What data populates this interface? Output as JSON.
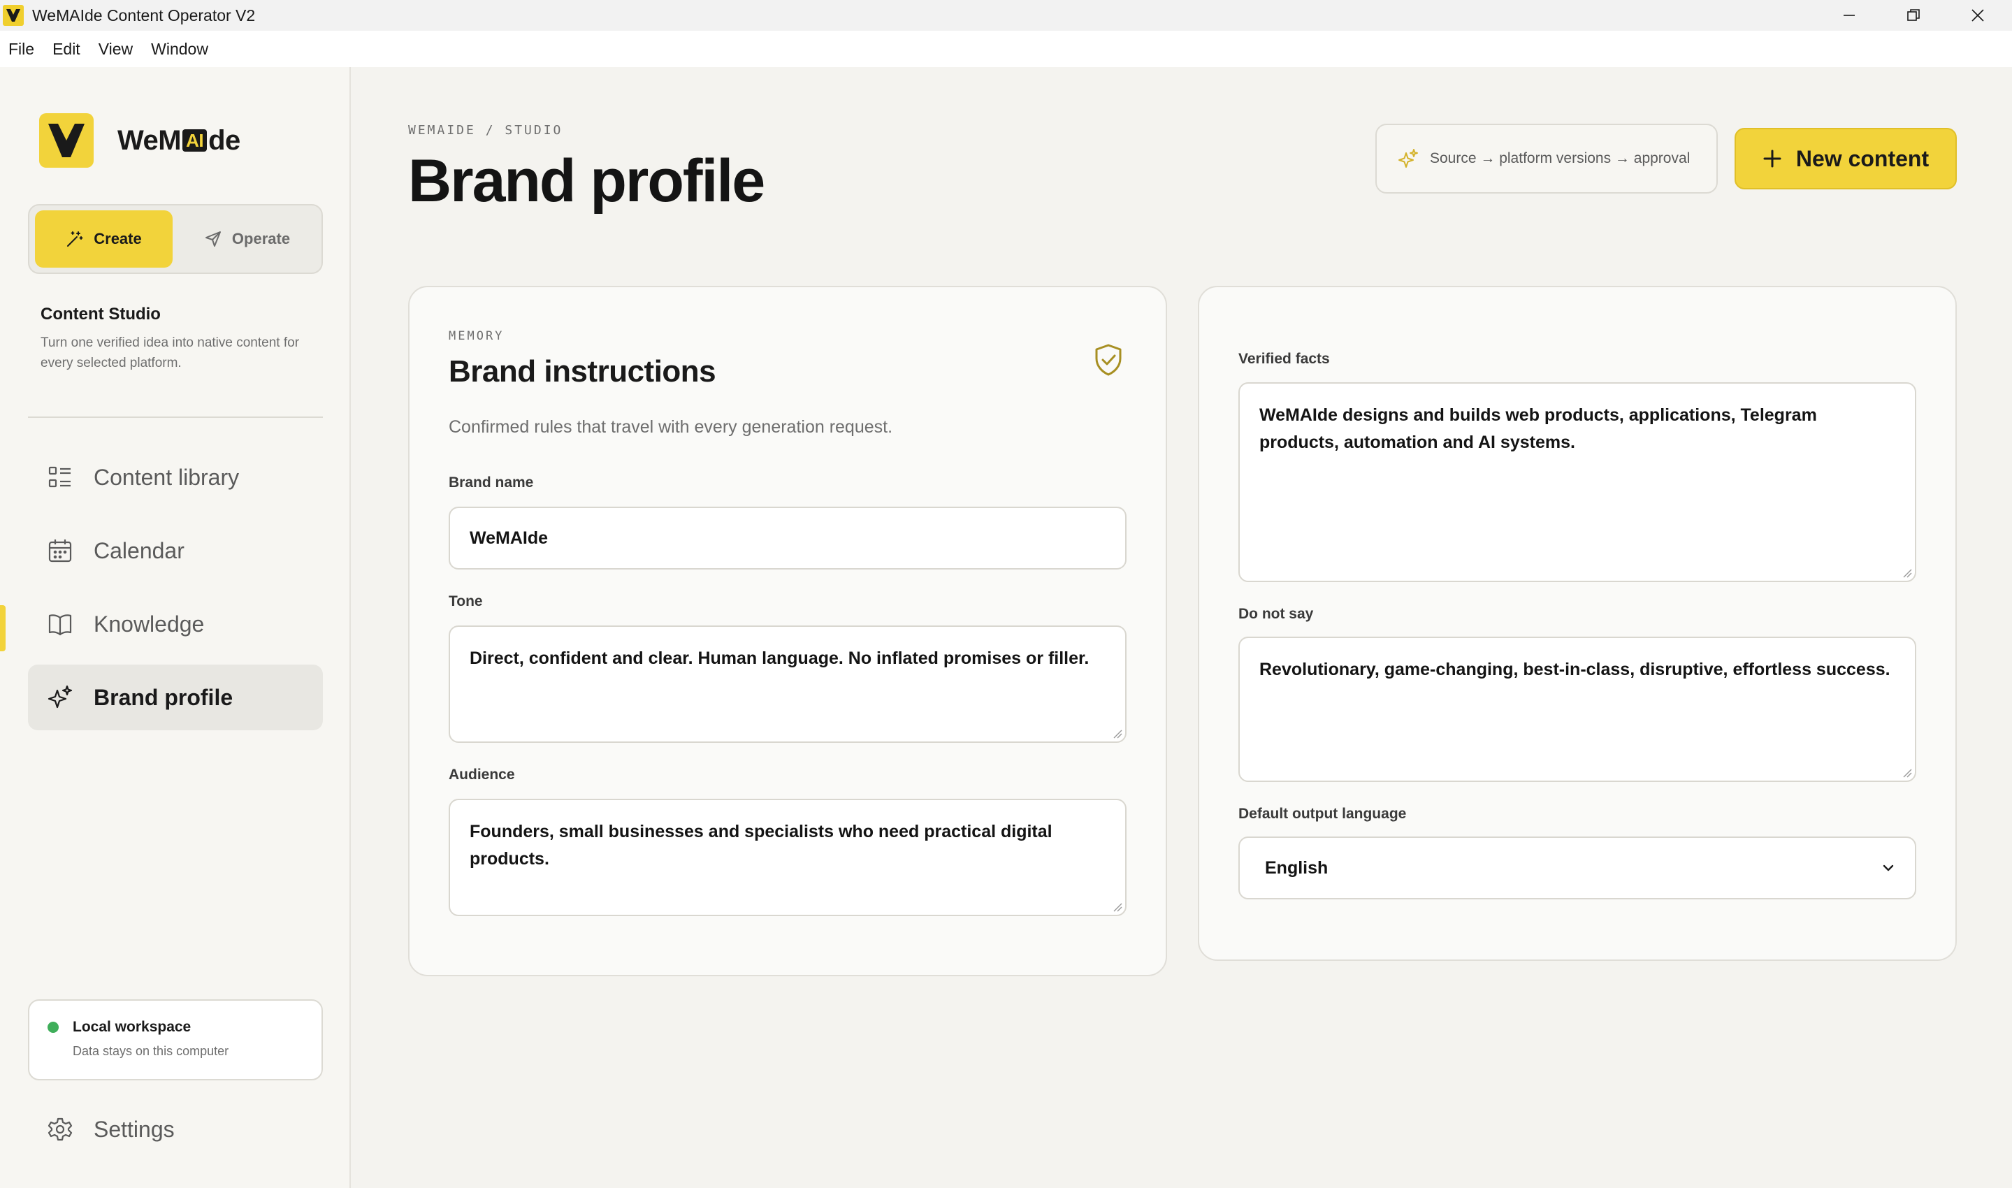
{
  "window": {
    "title": "WeMAIde Content Operator V2"
  },
  "menu": [
    "File",
    "Edit",
    "View",
    "Window"
  ],
  "sidebar": {
    "brand": {
      "word_before": "WeM",
      "word_ai": "AI",
      "word_after": "de"
    },
    "modes": {
      "create": "Create",
      "operate": "Operate"
    },
    "studio": {
      "title": "Content Studio",
      "description": "Turn one verified idea into native content for every selected platform."
    },
    "nav": [
      {
        "label": "Content library",
        "icon": "grid-list-icon"
      },
      {
        "label": "Calendar",
        "icon": "calendar-icon"
      },
      {
        "label": "Knowledge",
        "icon": "book-icon"
      },
      {
        "label": "Brand profile",
        "icon": "sparkles-icon",
        "active": true
      }
    ],
    "workspace": {
      "title": "Local workspace",
      "subtitle": "Data stays on this computer"
    },
    "settings": "Settings"
  },
  "header": {
    "breadcrumb": "WEMAIDE / STUDIO",
    "title": "Brand profile",
    "flow_pill": "Source → platform versions → approval",
    "new_content": "New content"
  },
  "brand_instructions": {
    "eyebrow": "MEMORY",
    "title": "Brand instructions",
    "subtitle": "Confirmed rules that travel with every generation request.",
    "brand_name_label": "Brand name",
    "brand_name_value": "WeMAIde",
    "tone_label": "Tone",
    "tone_value": "Direct, confident and clear. Human language. No inflated promises or filler.",
    "audience_label": "Audience",
    "audience_value": "Founders, small businesses and specialists who need practical digital products."
  },
  "facts": {
    "verified_label": "Verified facts",
    "verified_value": "WeMAIde designs and builds web products, applications, Telegram products, automation and AI systems.",
    "do_not_say_label": "Do not say",
    "do_not_say_value": "Revolutionary, game-changing, best-in-class, disruptive, effortless success.",
    "language_label": "Default output language",
    "language_value": "English"
  },
  "colors": {
    "accent": "#f2d33b",
    "background": "#f4f3ef",
    "status_online": "#3fae5a"
  }
}
